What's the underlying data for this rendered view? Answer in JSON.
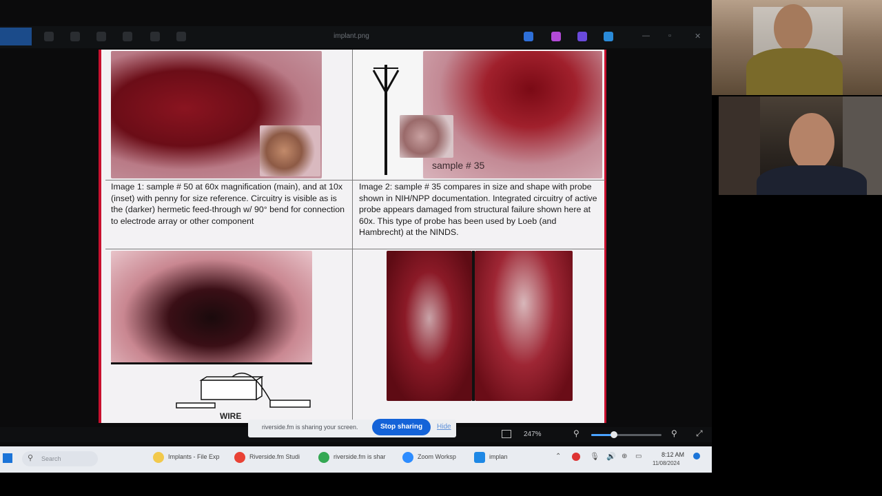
{
  "viewer": {
    "window_title": "implant.png",
    "app_badge": "",
    "zoom_level": "247%",
    "minimize_icon": "minimize-icon",
    "maximize_icon": "maximize-icon",
    "close_icon": "close-icon"
  },
  "slide": {
    "sample_label": "sample # 35",
    "caption_1": "Image 1: sample # 50 at 60x magnification (main), and at 10x (inset) with penny for size reference. Circuitry is visible as is the (darker) hermetic feed-through w/ 90° bend for connection to electrode array or other component",
    "caption_2": "Image 2: sample # 35 compares in size and shape with probe shown in NIH/NPP documentation. Integrated circuitry of active probe appears damaged from structural failure shown here at 60x. This type of probe has been used by Loeb (and Hambrecht) at the NINDS.",
    "wire_label": "WIRE"
  },
  "share_banner": {
    "text": "riverside.fm is sharing your screen.",
    "stop_label": "Stop sharing",
    "hide_label": "Hide"
  },
  "taskbar": {
    "search_placeholder": "Search",
    "apps": [
      {
        "label": "Implants - File Exp",
        "icon": "folder-icon",
        "color": "#f2c94c"
      },
      {
        "label": "Riverside.fm Studi",
        "icon": "chrome-icon",
        "color": "#e94235"
      },
      {
        "label": "riverside.fm is shar",
        "icon": "chrome-icon",
        "color": "#34a853"
      },
      {
        "label": "Zoom Worksp",
        "icon": "zoom-icon",
        "color": "#2d8cff"
      },
      {
        "label": "implan",
        "icon": "photos-icon",
        "color": "#1e88e5"
      }
    ],
    "time": "8:12 AM",
    "date": "11/08/2024"
  },
  "participants": [
    {
      "name_icon": "participant-video-1"
    },
    {
      "name_icon": "participant-video-2"
    }
  ],
  "colors": {
    "accent_red": "#c8102e",
    "stop_blue": "#1463d8"
  }
}
